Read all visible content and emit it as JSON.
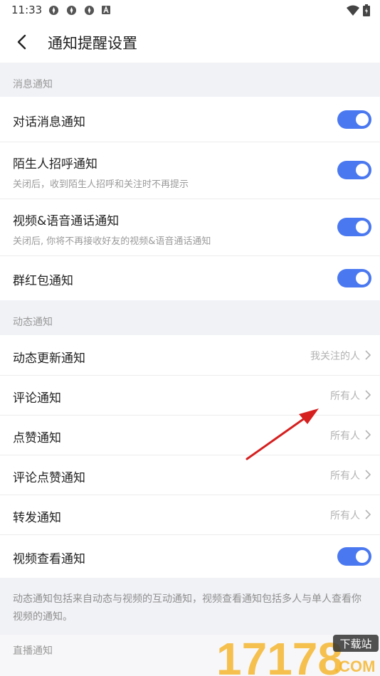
{
  "status_bar": {
    "time": "11:33",
    "icons": [
      "app-icon",
      "app-icon",
      "app-icon",
      "a-badge-icon"
    ],
    "right_icons": [
      "wifi-icon",
      "battery-icon"
    ]
  },
  "header": {
    "title": "通知提醒设置",
    "back_icon": "back-arrow-icon"
  },
  "sections": {
    "message": {
      "label": "消息通知",
      "items": [
        {
          "label": "对话消息通知",
          "toggle": true
        },
        {
          "label": "陌生人招呼通知",
          "subtitle": "关闭后，收到陌生人招呼和关注时不再提示",
          "toggle": true
        },
        {
          "label": "视频&语音通话通知",
          "subtitle": "关闭后, 你将不再接收好友的视频&语音通话通知",
          "toggle": true
        },
        {
          "label": "群红包通知",
          "toggle": true
        }
      ]
    },
    "dynamic": {
      "label": "动态通知",
      "items": [
        {
          "label": "动态更新通知",
          "value": "我关注的人"
        },
        {
          "label": "评论通知",
          "value": "所有人"
        },
        {
          "label": "点赞通知",
          "value": "所有人"
        },
        {
          "label": "评论点赞通知",
          "value": "所有人"
        },
        {
          "label": "转发通知",
          "value": "所有人"
        },
        {
          "label": "视频查看通知",
          "toggle": true
        }
      ],
      "note": "动态通知包括来自动态与视频的互动通知，视频查看通知包括多人与单人查看你视频的通知。"
    },
    "live": {
      "label": "直播通知"
    }
  },
  "watermark": {
    "text": "17178",
    "badge": "下载站",
    "domain": ".COM"
  },
  "colors": {
    "toggle_on": "#4a78f0",
    "annotation_arrow": "#d62020",
    "watermark": "#f5b324"
  }
}
